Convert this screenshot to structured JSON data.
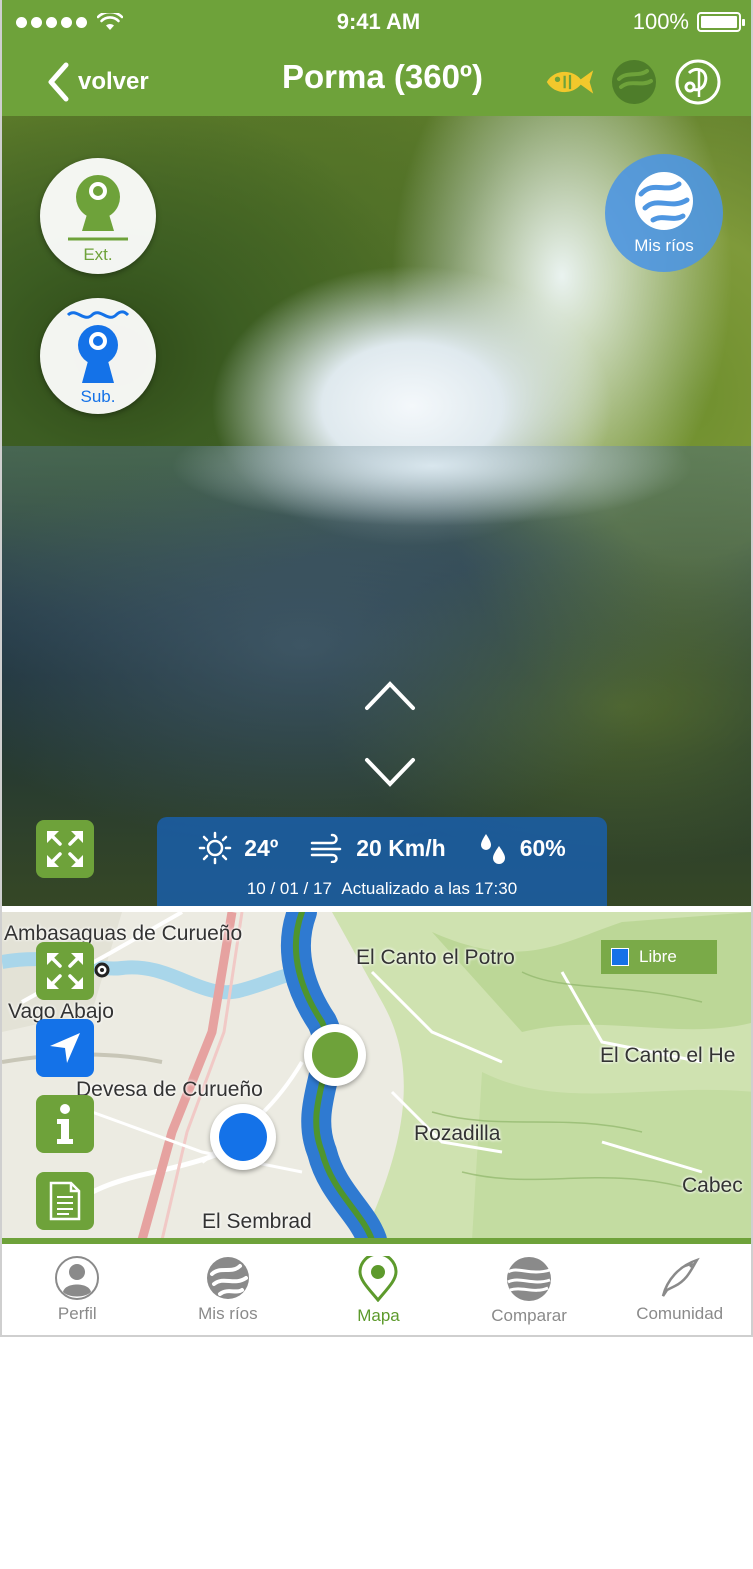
{
  "status_bar": {
    "time": "9:41 AM",
    "battery": "100%"
  },
  "nav": {
    "back_label": "volver",
    "title": "Porma (360º)",
    "icons": [
      "fish-icon",
      "river-icon",
      "fishing-hook-icon"
    ]
  },
  "panorama": {
    "camera_exterior_label": "Ext.",
    "camera_sub_label": "Sub.",
    "my_rivers_label": "Mis ríos",
    "weather": {
      "temperature": "24º",
      "wind": "20 Km/h",
      "humidity": "60%",
      "date": "10 / 01 / 17",
      "updated": "Actualizado a las 17:30"
    }
  },
  "map": {
    "legend_label": "Libre",
    "places": [
      "Ambasaguas de Curueño",
      "El Canto el Potro",
      "Vago Abajo",
      "El Canto el He",
      "Devesa de Curueño",
      "Rozadilla",
      "Cabec",
      "El Sembrad"
    ]
  },
  "tabs": [
    {
      "label": "Perfil",
      "icon": "profile-icon"
    },
    {
      "label": "Mis ríos",
      "icon": "river-icon"
    },
    {
      "label": "Mapa",
      "icon": "map-pin-icon"
    },
    {
      "label": "Comparar",
      "icon": "compare-icon"
    },
    {
      "label": "Comunidad",
      "icon": "fish-community-icon"
    }
  ],
  "colors": {
    "primary_green": "#6ea23a",
    "accent_blue": "#1472e8",
    "fish_yellow": "#f2c82c"
  }
}
